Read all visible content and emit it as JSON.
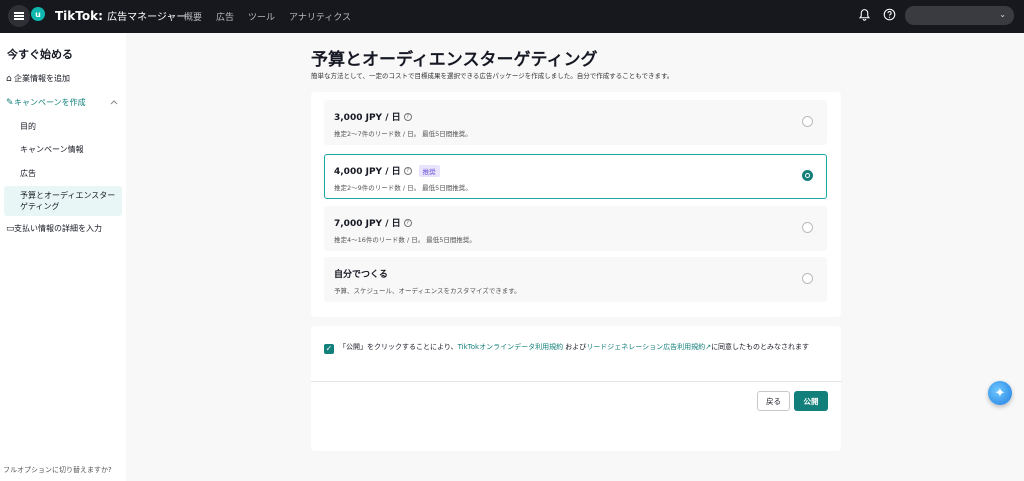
{
  "header": {
    "brand": "TikTok:",
    "brand_sub": "広告マネージャー",
    "avatar_letter": "u",
    "nav": [
      "概要",
      "広告",
      "ツール",
      "アナリティクス"
    ],
    "account_chevron": "⌄"
  },
  "sidebar": {
    "title": "今すぐ始める",
    "items": {
      "company": "企業情報を追加",
      "campaign": "キャンペーンを作成",
      "payment": "支払い情報の詳細を入力"
    },
    "subitems": [
      "目的",
      "キャンペーン情報",
      "広告",
      "予算とオーディエンスターゲティング"
    ],
    "footer": "フルオプションに切り替えますか?"
  },
  "main": {
    "title": "予算とオーディエンスターゲティング",
    "description": "簡単な方法として、一定のコストで目標成果を選択できる広告パッケージを作成しました。自分で作成することもできます。",
    "options": [
      {
        "title": "3,000 JPY / 日",
        "desc": "推定2～7件のリード数 / 日。 最低5日間推奨。",
        "badge": "",
        "selected": false
      },
      {
        "title": "4,000 JPY / 日",
        "desc": "推定2～9件のリード数 / 日。 最低5日間推奨。",
        "badge": "推奨",
        "selected": true
      },
      {
        "title": "7,000 JPY / 日",
        "desc": "推定4～16件のリード数 / 日。 最低5日間推奨。",
        "badge": "",
        "selected": false
      },
      {
        "title": "自分でつくる",
        "desc": "予算、スケジュール、オーディエンスをカスタマイズできます。",
        "badge": "",
        "selected": false
      }
    ],
    "terms": {
      "checked": true,
      "pre": "「公開」をクリックすることにより、",
      "link1": "TikTokオンラインデータ利用規約",
      "mid": " および",
      "link2": "リードジェネレーション広告利用規約",
      "post": "に同意したものとみなされます"
    },
    "back_label": "戻る",
    "publish_label": "公開"
  }
}
